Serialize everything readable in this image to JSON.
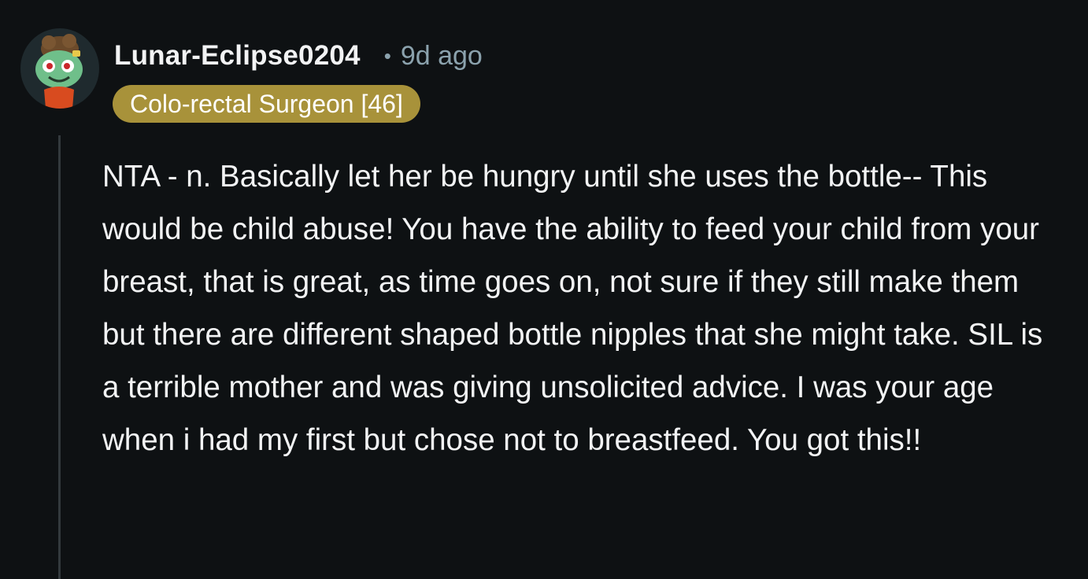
{
  "comment": {
    "avatar_icon": "snoo-avatar-icon",
    "author": "Lunar-Eclipse0204",
    "separator": "•",
    "timestamp": "9d ago",
    "flair": "Colo-rectal Surgeon [46]",
    "body": "NTA - n. Basically let her be hungry until she uses the bottle-- This would be child abuse! You have the ability to feed your child from your breast, that is great, as time goes on, not sure if they still make them but there are different shaped bottle nipples that she might take. SIL is a terrible mother and was giving unsolicited advice. I was your age when i had my first but chose not to breastfeed. You got this!!"
  },
  "colors": {
    "background": "#0e1113",
    "text": "#f2f3f4",
    "muted": "#8ba2ad",
    "flair_background": "#a8923a",
    "thread_line": "#33393d"
  }
}
